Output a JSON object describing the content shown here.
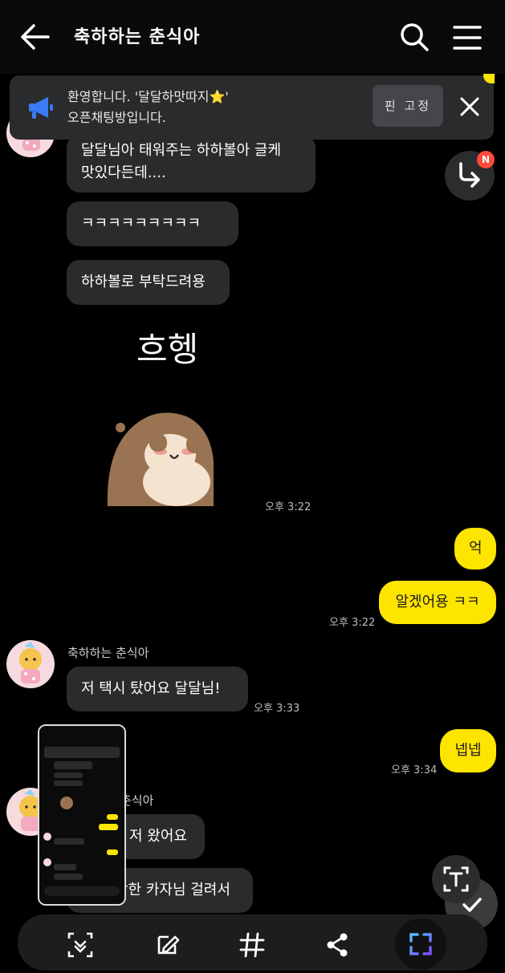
{
  "header": {
    "title": "축하하는 춘식아"
  },
  "notice": {
    "text_line1": "환영합니다. '달달하맛따지⭐'",
    "text_line2": "오픈채팅방입니다.",
    "pin_label": "핀 고정"
  },
  "reply_badge": "N",
  "messages": {
    "m1_line1": "달달님아 태워주는 하하볼아 글케",
    "m1_line2": "맛있다든데....",
    "m2": "ㅋㅋㅋㅋㅋㅋㅋㅋㅋ",
    "m3": "하하볼로 부탁드려용",
    "emoticon_text": "흐헹",
    "time1": "오후 3:22",
    "out1": "억",
    "out2": "알겠어용 ㅋㅋ",
    "time2": "오후 3:22",
    "sender2": "축하하는 춘식아",
    "m4": "저 택시 탔어요 달달님!",
    "time3": "오후 3:33",
    "out3": "넵넵",
    "time4": "오후 3:34",
    "sender3": "춘식아",
    "m5": "저 왔어요",
    "m6": "상한 카자님 걸려서"
  },
  "colors": {
    "outgoing_bubble": "#fee500",
    "incoming_bubble": "#2a2b2d",
    "badge": "#ff4a3a"
  },
  "toolbar": {
    "icons": [
      "scroll-capture-icon",
      "draw-icon",
      "hashtag-icon",
      "share-icon",
      "smart-select-icon"
    ]
  }
}
